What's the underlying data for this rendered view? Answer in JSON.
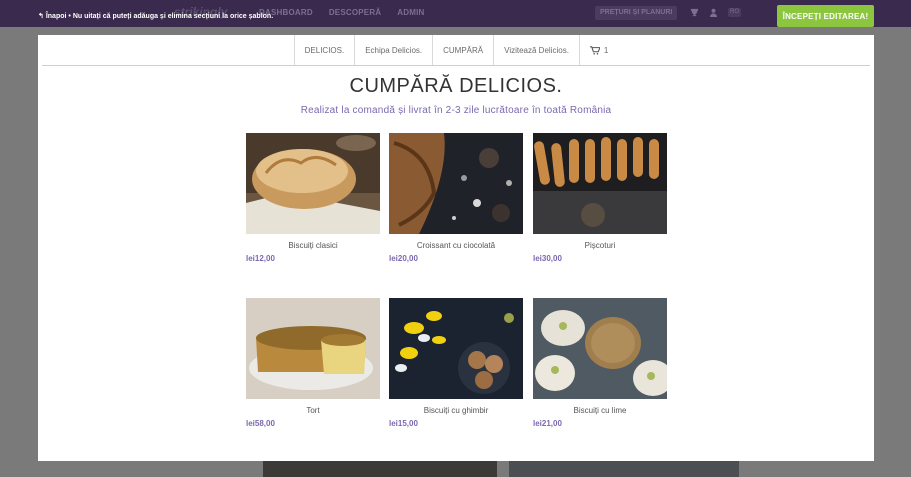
{
  "topbar": {
    "logo": "strikingly",
    "nav": [
      "DASHBOARD",
      "DESCOPERĂ",
      "ADMIN"
    ],
    "pricing_label": "PREȚURI ȘI PLANURI",
    "lang": "RO",
    "start_button": "ÎNCEPEȚI EDITAREA!"
  },
  "notice": {
    "back_label": "Înapoi",
    "separator": "•",
    "text": "Nu uitați că puteți adăuga și elimina secțiuni la orice șablon."
  },
  "site_nav": {
    "items": [
      "DELICIOS.",
      "Echipa Delicios.",
      "CUMPĂRĂ",
      "Vizitează Delicios."
    ],
    "cart_count": "1"
  },
  "section": {
    "title": "CUMPĂRĂ DELICIOS.",
    "subtitle": "Realizat la comandă și livrat în 2-3 zile lucrătoare în toată România"
  },
  "products": [
    {
      "name": "Biscuiți clasici",
      "price": "lei12,00"
    },
    {
      "name": "Croissant cu ciocolată",
      "price": "lei20,00"
    },
    {
      "name": "Pișcoturi",
      "price": "lei30,00"
    },
    {
      "name": "Tort",
      "price": "lei58,00"
    },
    {
      "name": "Biscuiți cu ghimbir",
      "price": "lei15,00"
    },
    {
      "name": "Biscuiți cu lime",
      "price": "lei21,00"
    }
  ],
  "colors": {
    "topbar": "#3a2a4e",
    "accent_green": "#8cc63f",
    "accent_purple": "#7b68b0"
  }
}
